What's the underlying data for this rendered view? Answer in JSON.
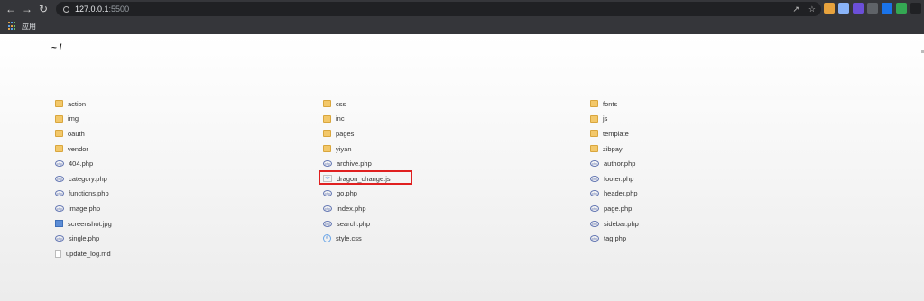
{
  "browser": {
    "url_host": "127.0.0.1",
    "url_port": ":5500",
    "extension_colors": [
      "#e8a33d",
      "#8ab4f8",
      "#6b4fd8",
      "#5f6368",
      "#1a73e8",
      "#34a853",
      "#202124"
    ],
    "bookmarks_label": "应用"
  },
  "page": {
    "breadcrumb": "~ /"
  },
  "files": [
    {
      "name": "action",
      "type": "folder"
    },
    {
      "name": "css",
      "type": "folder"
    },
    {
      "name": "fonts",
      "type": "folder"
    },
    {
      "name": "img",
      "type": "folder"
    },
    {
      "name": "inc",
      "type": "folder"
    },
    {
      "name": "js",
      "type": "folder"
    },
    {
      "name": "oauth",
      "type": "folder"
    },
    {
      "name": "pages",
      "type": "folder"
    },
    {
      "name": "template",
      "type": "folder"
    },
    {
      "name": "vendor",
      "type": "folder"
    },
    {
      "name": "yiyan",
      "type": "folder"
    },
    {
      "name": "zibpay",
      "type": "folder"
    },
    {
      "name": "404.php",
      "type": "php"
    },
    {
      "name": "archive.php",
      "type": "php"
    },
    {
      "name": "author.php",
      "type": "php"
    },
    {
      "name": "category.php",
      "type": "php"
    },
    {
      "name": "dragon_change.js",
      "type": "js"
    },
    {
      "name": "footer.php",
      "type": "php"
    },
    {
      "name": "functions.php",
      "type": "php"
    },
    {
      "name": "go.php",
      "type": "php"
    },
    {
      "name": "header.php",
      "type": "php"
    },
    {
      "name": "image.php",
      "type": "php"
    },
    {
      "name": "index.php",
      "type": "php"
    },
    {
      "name": "page.php",
      "type": "php"
    },
    {
      "name": "screenshot.jpg",
      "type": "image"
    },
    {
      "name": "search.php",
      "type": "php"
    },
    {
      "name": "sidebar.php",
      "type": "php"
    },
    {
      "name": "single.php",
      "type": "php"
    },
    {
      "name": "style.css",
      "type": "css"
    },
    {
      "name": "tag.php",
      "type": "php"
    },
    {
      "name": "update_log.md",
      "type": "doc"
    }
  ],
  "highlight_color": "#e02020"
}
